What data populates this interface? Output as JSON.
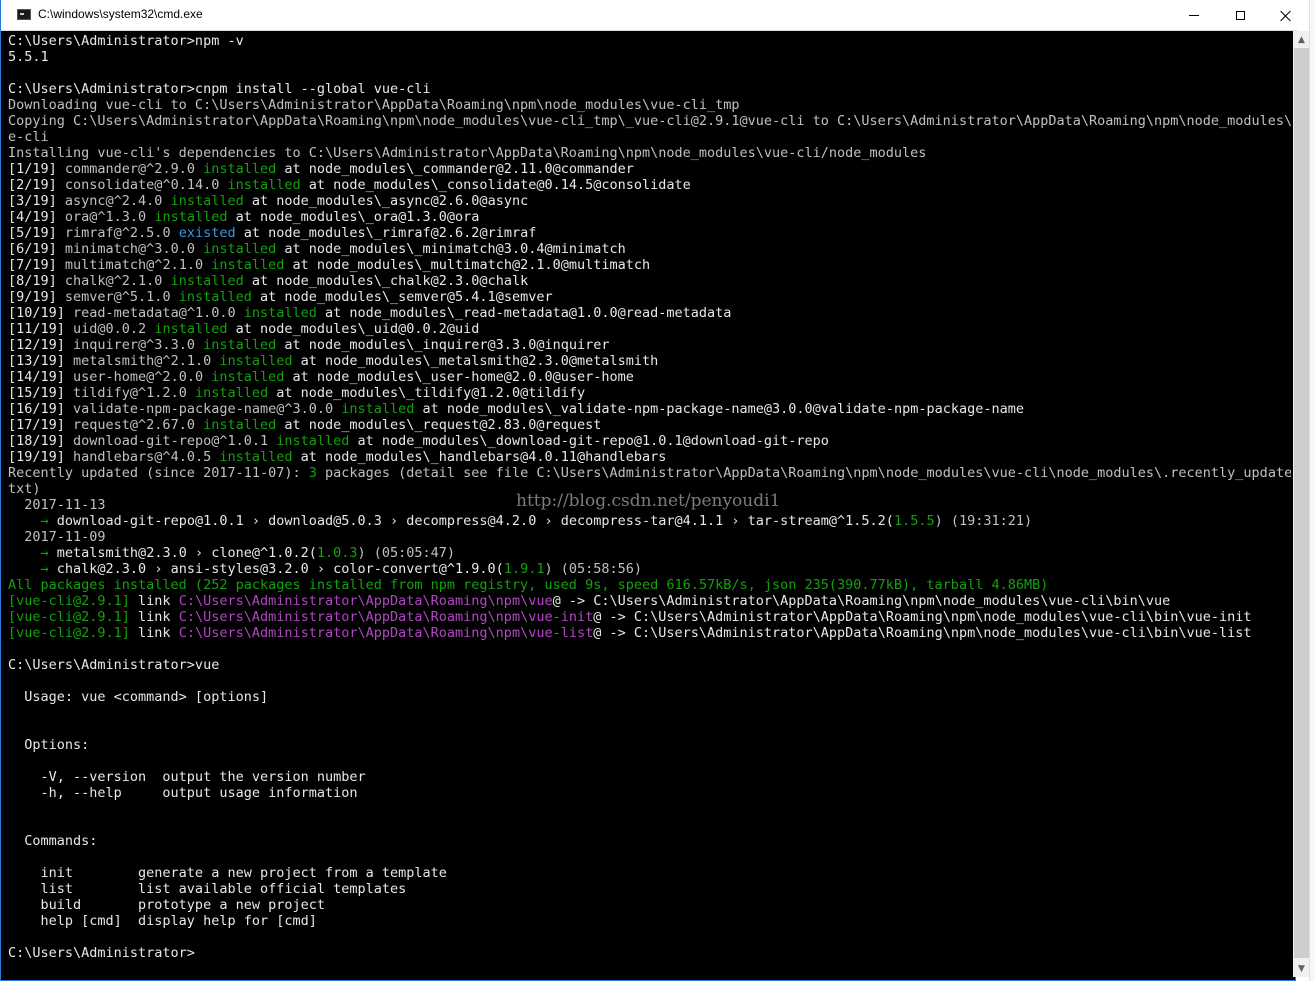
{
  "window": {
    "title": "C:\\windows\\system32\\cmd.exe",
    "min_label": "—",
    "max_label": "☐",
    "close_label": "✕"
  },
  "watermark": "http://blog.csdn.net/penyoudi1",
  "colors": {
    "background": "#000000",
    "text": "#c0c0c0",
    "installed": "#13a10e",
    "existed": "#3a96dd",
    "path_magenta": "#b146c2"
  },
  "console_lines": [
    [
      [
        "C:\\Users\\Administrator>npm -v",
        "w"
      ]
    ],
    [
      [
        "5.5.1",
        "w"
      ]
    ],
    [
      [
        "",
        ""
      ]
    ],
    [
      [
        "C:\\Users\\Administrator>cnpm install --global vue-cli",
        "w"
      ]
    ],
    [
      [
        "Downloading vue-cli to C:\\Users\\Administrator\\AppData\\Roaming\\npm\\node_modules\\vue-cli_tmp",
        ""
      ]
    ],
    [
      [
        "Copying C:\\Users\\Administrator\\AppData\\Roaming\\npm\\node_modules\\vue-cli_tmp\\_vue-cli@2.9.1@vue-cli to C:\\Users\\Administrator\\AppData\\Roaming\\npm\\node_modules\\vu",
        ""
      ]
    ],
    [
      [
        "e-cli",
        ""
      ]
    ],
    [
      [
        "Installing vue-cli's dependencies to C:\\Users\\Administrator\\AppData\\Roaming\\npm\\node_modules\\vue-cli/node_modules",
        ""
      ]
    ],
    [
      [
        "[1/19] ",
        "w"
      ],
      [
        "commander@^2.9.0 ",
        ""
      ],
      [
        "installed",
        "g"
      ],
      [
        " at node_modules\\_commander@2.11.0@commander",
        "w"
      ]
    ],
    [
      [
        "[2/19] ",
        "w"
      ],
      [
        "consolidate@^0.14.0 ",
        ""
      ],
      [
        "installed",
        "g"
      ],
      [
        " at node_modules\\_consolidate@0.14.5@consolidate",
        "w"
      ]
    ],
    [
      [
        "[3/19] ",
        "w"
      ],
      [
        "async@^2.4.0 ",
        ""
      ],
      [
        "installed",
        "g"
      ],
      [
        " at node_modules\\_async@2.6.0@async",
        "w"
      ]
    ],
    [
      [
        "[4/19] ",
        "w"
      ],
      [
        "ora@^1.3.0 ",
        ""
      ],
      [
        "installed",
        "g"
      ],
      [
        " at node_modules\\_ora@1.3.0@ora",
        "w"
      ]
    ],
    [
      [
        "[5/19] ",
        "w"
      ],
      [
        "rimraf@^2.5.0 ",
        ""
      ],
      [
        "existed",
        "t"
      ],
      [
        " at node_modules\\_rimraf@2.6.2@rimraf",
        "w"
      ]
    ],
    [
      [
        "[6/19] ",
        "w"
      ],
      [
        "minimatch@^3.0.0 ",
        ""
      ],
      [
        "installed",
        "g"
      ],
      [
        " at node_modules\\_minimatch@3.0.4@minimatch",
        "w"
      ]
    ],
    [
      [
        "[7/19] ",
        "w"
      ],
      [
        "multimatch@^2.1.0 ",
        ""
      ],
      [
        "installed",
        "g"
      ],
      [
        " at node_modules\\_multimatch@2.1.0@multimatch",
        "w"
      ]
    ],
    [
      [
        "[8/19] ",
        "w"
      ],
      [
        "chalk@^2.1.0 ",
        ""
      ],
      [
        "installed",
        "g"
      ],
      [
        " at node_modules\\_chalk@2.3.0@chalk",
        "w"
      ]
    ],
    [
      [
        "[9/19] ",
        "w"
      ],
      [
        "semver@^5.1.0 ",
        ""
      ],
      [
        "installed",
        "g"
      ],
      [
        " at node_modules\\_semver@5.4.1@semver",
        "w"
      ]
    ],
    [
      [
        "[10/19] ",
        "w"
      ],
      [
        "read-metadata@^1.0.0 ",
        ""
      ],
      [
        "installed",
        "g"
      ],
      [
        " at node_modules\\_read-metadata@1.0.0@read-metadata",
        "w"
      ]
    ],
    [
      [
        "[11/19] ",
        "w"
      ],
      [
        "uid@0.0.2 ",
        ""
      ],
      [
        "installed",
        "g"
      ],
      [
        " at node_modules\\_uid@0.0.2@uid",
        "w"
      ]
    ],
    [
      [
        "[12/19] ",
        "w"
      ],
      [
        "inquirer@^3.3.0 ",
        ""
      ],
      [
        "installed",
        "g"
      ],
      [
        " at node_modules\\_inquirer@3.3.0@inquirer",
        "w"
      ]
    ],
    [
      [
        "[13/19] ",
        "w"
      ],
      [
        "metalsmith@^2.1.0 ",
        ""
      ],
      [
        "installed",
        "g"
      ],
      [
        " at node_modules\\_metalsmith@2.3.0@metalsmith",
        "w"
      ]
    ],
    [
      [
        "[14/19] ",
        "w"
      ],
      [
        "user-home@^2.0.0 ",
        ""
      ],
      [
        "installed",
        "g"
      ],
      [
        " at node_modules\\_user-home@2.0.0@user-home",
        "w"
      ]
    ],
    [
      [
        "[15/19] ",
        "w"
      ],
      [
        "tildify@^1.2.0 ",
        ""
      ],
      [
        "installed",
        "g"
      ],
      [
        " at node_modules\\_tildify@1.2.0@tildify",
        "w"
      ]
    ],
    [
      [
        "[16/19] ",
        "w"
      ],
      [
        "validate-npm-package-name@^3.0.0 ",
        ""
      ],
      [
        "installed",
        "g"
      ],
      [
        " at node_modules\\_validate-npm-package-name@3.0.0@validate-npm-package-name",
        "w"
      ]
    ],
    [
      [
        "[17/19] ",
        "w"
      ],
      [
        "request@^2.67.0 ",
        ""
      ],
      [
        "installed",
        "g"
      ],
      [
        " at node_modules\\_request@2.83.0@request",
        "w"
      ]
    ],
    [
      [
        "[18/19] ",
        "w"
      ],
      [
        "download-git-repo@^1.0.1 ",
        ""
      ],
      [
        "installed",
        "g"
      ],
      [
        " at node_modules\\_download-git-repo@1.0.1@download-git-repo",
        "w"
      ]
    ],
    [
      [
        "[19/19] ",
        "w"
      ],
      [
        "handlebars@^4.0.5 ",
        ""
      ],
      [
        "installed",
        "g"
      ],
      [
        " at node_modules\\_handlebars@4.0.11@handlebars",
        "w"
      ]
    ],
    [
      [
        "Recently updated (since 2017-11-07): ",
        ""
      ],
      [
        "3",
        "g"
      ],
      [
        " packages (detail see file C:\\Users\\Administrator\\AppData\\Roaming\\npm\\node_modules\\vue-cli\\node_modules\\.recently_updates.",
        ""
      ]
    ],
    [
      [
        "txt)",
        ""
      ]
    ],
    [
      [
        "  2017-11-13",
        ""
      ]
    ],
    [
      [
        "    ",
        "g"
      ],
      [
        "→",
        "g"
      ],
      [
        " download-git-repo@1.0.1 › download@5.0.3 › decompress@4.2.0 › decompress-tar@4.1.1 › tar-stream@^1.5.2(",
        "w"
      ],
      [
        "1.5.5",
        "g"
      ],
      [
        ") (19:31:21)",
        ""
      ]
    ],
    [
      [
        "  2017-11-09",
        ""
      ]
    ],
    [
      [
        "    ",
        "g"
      ],
      [
        "→",
        "g"
      ],
      [
        " metalsmith@2.3.0 › clone@^1.0.2(",
        "w"
      ],
      [
        "1.0.3",
        "g"
      ],
      [
        ") (05:05:47)",
        ""
      ]
    ],
    [
      [
        "    ",
        "g"
      ],
      [
        "→",
        "g"
      ],
      [
        " chalk@2.3.0 › ansi-styles@3.2.0 › color-convert@^1.9.0(",
        "w"
      ],
      [
        "1.9.1",
        "g"
      ],
      [
        ") (05:58:56)",
        ""
      ]
    ],
    [
      [
        "All packages installed (252 packages installed from npm registry, used 9s, speed 616.57kB/s, json 235(390.77kB), tarball 4.86MB)",
        "g"
      ]
    ],
    [
      [
        "[vue-cli@2.9.1]",
        "g"
      ],
      [
        " link ",
        "w"
      ],
      [
        "C:\\Users\\Administrator\\AppData\\Roaming\\npm\\vue",
        "m"
      ],
      [
        "@ -> C:\\Users\\Administrator\\AppData\\Roaming\\npm\\node_modules\\vue-cli\\bin\\vue",
        "w"
      ]
    ],
    [
      [
        "[vue-cli@2.9.1]",
        "g"
      ],
      [
        " link ",
        "w"
      ],
      [
        "C:\\Users\\Administrator\\AppData\\Roaming\\npm\\vue-init",
        "m"
      ],
      [
        "@ -> C:\\Users\\Administrator\\AppData\\Roaming\\npm\\node_modules\\vue-cli\\bin\\vue-init",
        "w"
      ]
    ],
    [
      [
        "[vue-cli@2.9.1]",
        "g"
      ],
      [
        " link ",
        "w"
      ],
      [
        "C:\\Users\\Administrator\\AppData\\Roaming\\npm\\vue-list",
        "m"
      ],
      [
        "@ -> C:\\Users\\Administrator\\AppData\\Roaming\\npm\\node_modules\\vue-cli\\bin\\vue-list",
        "w"
      ]
    ],
    [
      [
        "",
        ""
      ]
    ],
    [
      [
        "C:\\Users\\Administrator>vue",
        "w"
      ]
    ],
    [
      [
        "",
        ""
      ]
    ],
    [
      [
        "  Usage: vue <command> [options]",
        "w"
      ]
    ],
    [
      [
        "",
        ""
      ]
    ],
    [
      [
        "",
        ""
      ]
    ],
    [
      [
        "  Options:",
        "w"
      ]
    ],
    [
      [
        "",
        ""
      ]
    ],
    [
      [
        "    -V, --version  output the version number",
        "w"
      ]
    ],
    [
      [
        "    -h, --help     output usage information",
        "w"
      ]
    ],
    [
      [
        "",
        ""
      ]
    ],
    [
      [
        "",
        ""
      ]
    ],
    [
      [
        "  Commands:",
        "w"
      ]
    ],
    [
      [
        "",
        ""
      ]
    ],
    [
      [
        "    init        generate a new project from a template",
        "w"
      ]
    ],
    [
      [
        "    list        list available official templates",
        "w"
      ]
    ],
    [
      [
        "    build       prototype a new project",
        "w"
      ]
    ],
    [
      [
        "    help [cmd]  display help for [cmd]",
        "w"
      ]
    ],
    [
      [
        "",
        ""
      ]
    ],
    [
      [
        "C:\\Users\\Administrator>",
        "w"
      ]
    ]
  ]
}
